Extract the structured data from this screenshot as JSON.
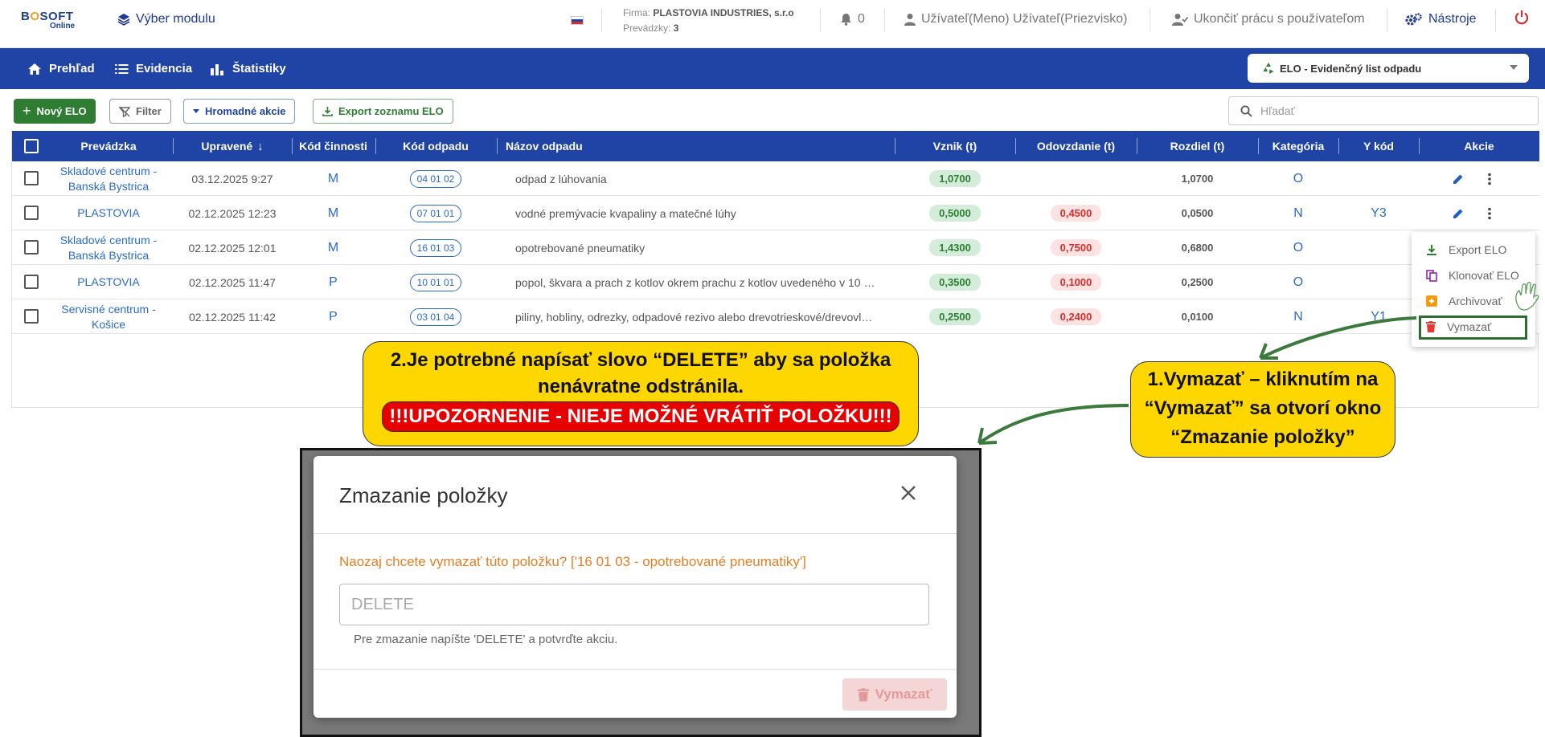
{
  "brand": {
    "line1a": "B",
    "line1b": "S",
    "line1c": "FT",
    "line2": "Online",
    "o_char": "O"
  },
  "topbar": {
    "module_selector": "Výber modulu",
    "firm_label": "Firma:",
    "firm_name": "PLASTOVIA INDUSTRIES, s.r.o",
    "prevadzky_label": "Prevádzky:",
    "prevadzky_count": "3",
    "notifications": "0",
    "user": "Užívateľ(Meno) Užívateľ(Priezvisko)",
    "end_session": "Ukončiť prácu s používateľom",
    "tools": "Nástroje"
  },
  "nav": {
    "items": [
      "Prehľad",
      "Evidencia",
      "Štatistiky"
    ],
    "module": "ELO - Evidenčný list odpadu"
  },
  "toolbar": {
    "new": "Nový ELO",
    "filter": "Filter",
    "bulk": "Hromadné akcie",
    "export": "Export zoznamu ELO",
    "search_placeholder": "Hľadať"
  },
  "table": {
    "headers": [
      "Prevádzka",
      "Upravené",
      "Kód činnosti",
      "Kód odpadu",
      "Názov odpadu",
      "Vznik (t)",
      "Odovzdanie (t)",
      "Rozdiel (t)",
      "Kategória",
      "Y kód",
      "Akcie"
    ],
    "rows": [
      {
        "prevadzka": "Skladové centrum - Banská Bystrica",
        "upravene": "03.12.2025 9:27",
        "kod": "M",
        "kod_odpadu": "04 01 02",
        "nazov": "odpad z lúhovania",
        "vznik": "1,0700",
        "odovzdanie": "",
        "rozdiel": "1,0700",
        "kategoria": "O",
        "ykod": ""
      },
      {
        "prevadzka": "PLASTOVIA",
        "upravene": "02.12.2025 12:23",
        "kod": "M",
        "kod_odpadu": "07 01 01",
        "nazov": "vodné premývacie kvapaliny a matečné lúhy",
        "vznik": "0,5000",
        "odovzdanie": "0,4500",
        "rozdiel": "0,0500",
        "kategoria": "N",
        "ykod": "Y3"
      },
      {
        "prevadzka": "Skladové centrum - Banská Bystrica",
        "upravene": "02.12.2025 12:01",
        "kod": "M",
        "kod_odpadu": "16 01 03",
        "nazov": "opotrebované pneumatiky",
        "vznik": "1,4300",
        "odovzdanie": "0,7500",
        "rozdiel": "0,6800",
        "kategoria": "O",
        "ykod": ""
      },
      {
        "prevadzka": "PLASTOVIA",
        "upravene": "02.12.2025 11:47",
        "kod": "P",
        "kod_odpadu": "10 01 01",
        "nazov": "popol, škvara a prach z kotlov okrem prachu z kotlov uvedeného v 10 …",
        "vznik": "0,3500",
        "odovzdanie": "0,1000",
        "rozdiel": "0,2500",
        "kategoria": "O",
        "ykod": ""
      },
      {
        "prevadzka": "Servisné centrum - Košice",
        "upravene": "02.12.2025 11:42",
        "kod": "P",
        "kod_odpadu": "03 01 04",
        "nazov": "piliny, hobliny, odrezky, odpadové rezivo alebo drevotrieskové/drevovl…",
        "vznik": "0,2500",
        "odovzdanie": "0,2400",
        "rozdiel": "0,0100",
        "kategoria": "N",
        "ykod": "Y1"
      }
    ]
  },
  "menu": {
    "items": [
      "Export ELO",
      "Klonovať ELO",
      "Archivovať",
      "Vymazať"
    ]
  },
  "callouts": {
    "step2_line1": "2.Je potrebné napísať slovo “DELETE” aby sa položka",
    "step2_line2": "nenávratne odstránila.",
    "step2_warning": "!!!UPOZORNENIE - NIEJE MOŽNÉ VRÁTIŤ POLOŽKU!!!",
    "step1_line1": "1.Vymazať – kliknutím na",
    "step1_line2": "“Vymazať” sa otvorí okno",
    "step1_line3": "“Zmazanie položky”"
  },
  "dialog": {
    "title": "Zmazanie položky",
    "question": "Naozaj chcete vymazať túto položku? ['16 01 03 - opotrebované pneumatiky']",
    "placeholder": "DELETE",
    "hint": "Pre zmazanie napíšte 'DELETE' a potvrďte akciu.",
    "confirm": "Vymazať"
  },
  "colors": {
    "primary": "#1f44a6",
    "accent_green": "#2e7d32",
    "danger": "#d32f2f",
    "callout": "#ffd700"
  }
}
